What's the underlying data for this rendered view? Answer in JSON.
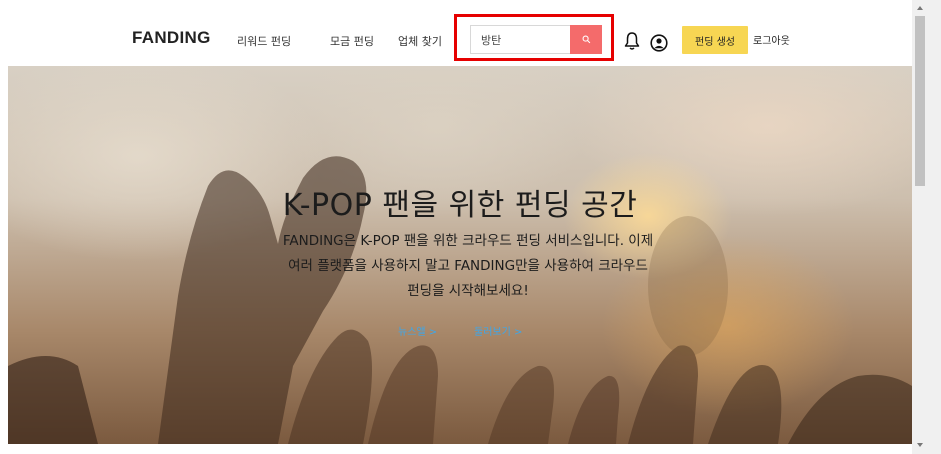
{
  "header": {
    "logo": "FANDING",
    "nav": [
      {
        "label": "리워드 펀딩"
      },
      {
        "label": "모금 펀딩"
      },
      {
        "label": "업체 찾기"
      }
    ],
    "search": {
      "value": "방탄",
      "placeholder": ""
    },
    "create_label": "펀딩 생성",
    "logout_label": "로그아웃"
  },
  "hero": {
    "title": "K-POP 팬을 위한 펀딩 공간",
    "desc_line1": "FANDING은 K-POP 팬을 위한 크라우드 펀딩 서비스입니다. 이제",
    "desc_line2": "여러 플랫폼을 사용하지 말고 FANDING만을 사용하여 크라우드",
    "desc_line3": "펀딩을 시작해보세요!",
    "link1": "뉴스앨 >",
    "link2": "둘러보기 >"
  },
  "colors": {
    "search_button": "#f46b6b",
    "create_button": "#f7d653",
    "highlight_border": "#e60000",
    "hero_link": "#3fa6e8"
  },
  "icons": {
    "search": "search-icon",
    "notifications": "bell-icon",
    "account": "user-circle-icon"
  }
}
